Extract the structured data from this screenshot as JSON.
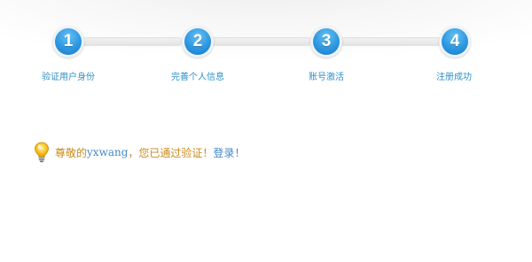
{
  "steps": [
    {
      "number": "1",
      "label": "验证用户身份"
    },
    {
      "number": "2",
      "label": "完善个人信息"
    },
    {
      "number": "3",
      "label": "账号激活"
    },
    {
      "number": "4",
      "label": "注册成功"
    }
  ],
  "message": {
    "prefix": "尊敬的",
    "username": "yxwang",
    "body": "，您已通过验证！",
    "login_link": "登录",
    "suffix": "！",
    "icon": "lightbulb-icon"
  },
  "colors": {
    "step_blue": "#2d97e0",
    "label_blue": "#2f8fc9",
    "message_orange": "#c98a1c",
    "link_blue": "#3f8ac8"
  }
}
